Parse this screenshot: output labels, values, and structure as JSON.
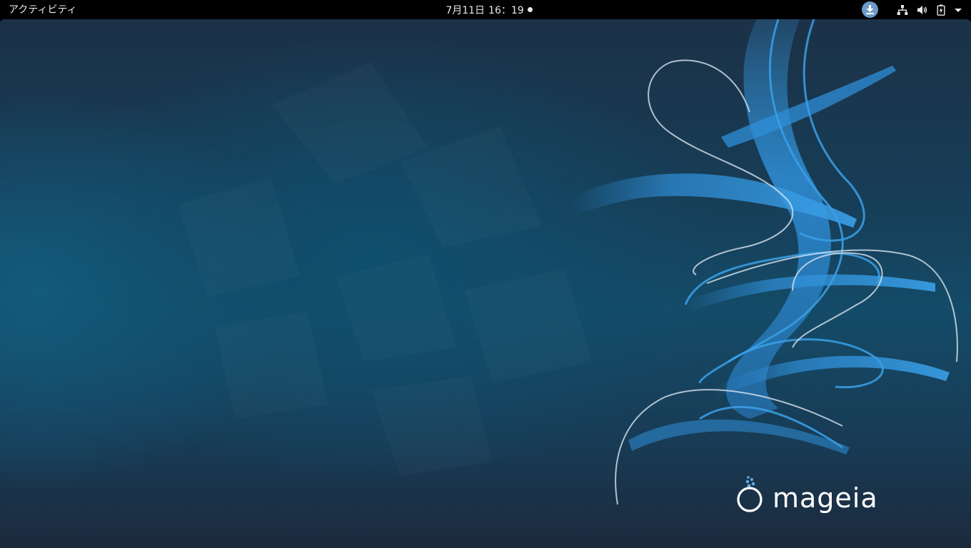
{
  "topbar": {
    "activities_label": "アクティビティ",
    "clock": {
      "date": "7月11日",
      "time": "16：19"
    }
  },
  "tray": {
    "icons": [
      "software-update-icon",
      "network-icon",
      "volume-icon",
      "battery-icon",
      "system-menu-chevron-icon"
    ]
  },
  "desktop": {
    "logo_text": "mageia"
  },
  "colors": {
    "topbar_bg": "#000000",
    "topbar_text": "#e8e8e8",
    "wallpaper_dark": "#1b3147",
    "wallpaper_mid": "#144b68",
    "swirl_blue": "#2f8fd8",
    "update_badge": "#6c9cc8"
  }
}
